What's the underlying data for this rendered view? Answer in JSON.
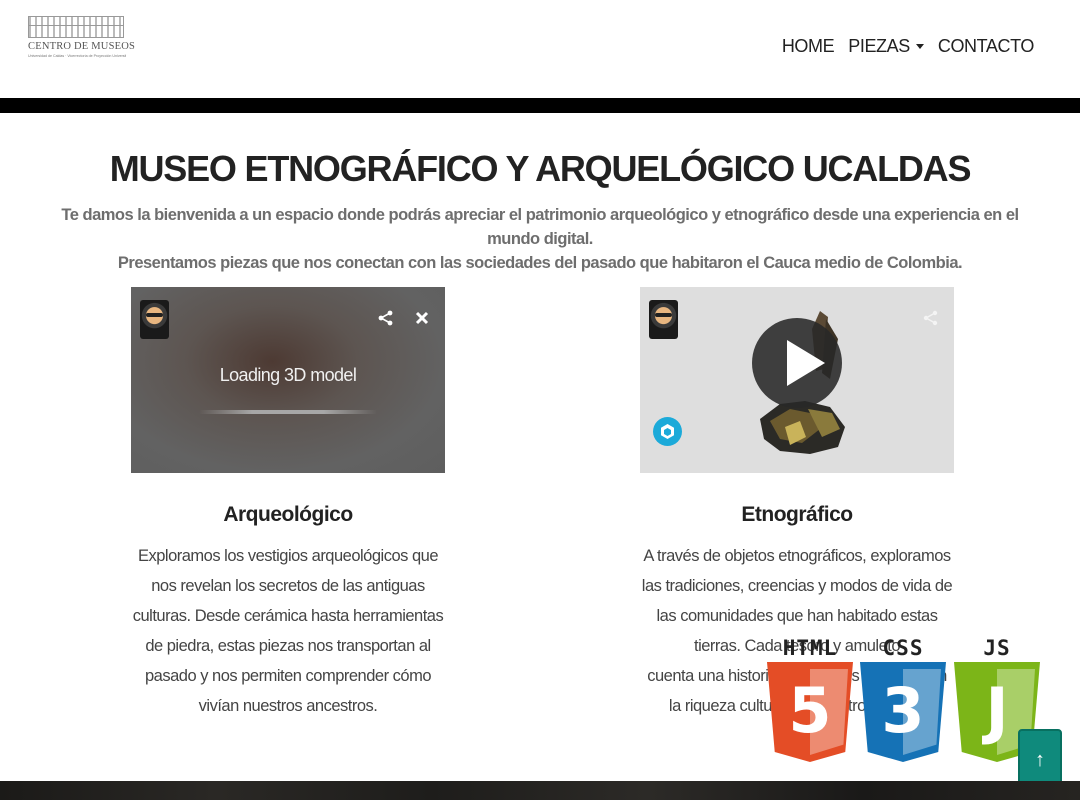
{
  "header": {
    "logo": {
      "name": "CENTRO DE MUSEOS",
      "subtitle": "Universidad de Caldas · Vicerrectoría de Proyección Universitaria"
    },
    "nav": [
      {
        "label": "HOME"
      },
      {
        "label": "PIEZAS",
        "has_dropdown": true
      },
      {
        "label": "CONTACTO"
      }
    ]
  },
  "hero": {
    "title": "MUSEO ETNOGRÁFICO Y ARQUELÓGICO UCALDAS",
    "intro_line1": "Te damos la bienvenida a un espacio donde podrás apreciar el patrimonio arqueológico y etnográfico desde una experiencia en el mundo digital.",
    "intro_line2": "Presentamos piezas que nos conectan con las sociedades del pasado que habitaron el Cauca medio de Colombia."
  },
  "viewers": {
    "left": {
      "status": "Loading 3D model",
      "icons": [
        "avatar",
        "share-icon",
        "close-icon"
      ]
    },
    "right": {
      "icons": [
        "avatar",
        "share-icon",
        "play-icon",
        "sketchfab-icon"
      ]
    }
  },
  "cards": [
    {
      "title": "Arqueológico",
      "lines": [
        "Exploramos los vestigios arqueológicos que",
        "nos revelan los secretos de las antiguas",
        "culturas. Desde cerámica hasta herramientas",
        "de piedra, estas piezas nos transportan al",
        "pasado y nos permiten comprender cómo",
        "vivían nuestros ancestros."
      ]
    },
    {
      "title": "Etnográfico",
      "lines": [
        "A través de objetos etnográficos, exploramos",
        "las tradiciones, creencias y modos de vida de",
        "las comunidades que han habitado estas",
        "tierras. Cada tesoro y amuleto",
        "cuenta una historia única y nos conecta con",
        "la riqueza cultural de nuestro pasado."
      ]
    }
  ],
  "badges": [
    {
      "label": "HTML",
      "number": "5",
      "color": "#e44d26",
      "inner": "#f16529"
    },
    {
      "label": "CSS",
      "number": "3",
      "color": "#1572b6",
      "inner": "#33a9dc"
    },
    {
      "label": "JS",
      "number": "J",
      "color": "#7cb518",
      "inner": "#a3d92a"
    }
  ],
  "back_to_top": {
    "glyph": "↑"
  },
  "colors": {
    "nav_text": "#222222",
    "intro_text": "#6e6e6e",
    "back_to_top": "#0f8a7c"
  }
}
